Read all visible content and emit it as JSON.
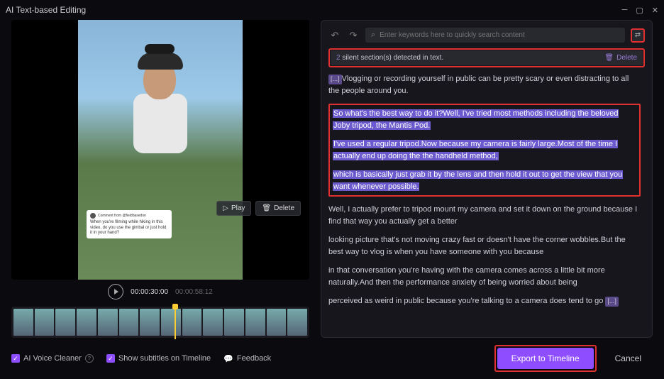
{
  "window": {
    "title": "AI Text-based Editing"
  },
  "preview": {
    "subtitle_header": "Comment from @fieldbasedon",
    "subtitle_text": "When you're filming while hiking in this video, do you use the gimbal or just hold it in your hand?",
    "play_label": "Play",
    "delete_label": "Delete"
  },
  "transport": {
    "current": "00:00:30:00",
    "total": "00:00:58:12"
  },
  "search": {
    "placeholder": "Enter keywords here to quickly search content"
  },
  "banner": {
    "count": "2",
    "text": " silent section(s) detected in text.",
    "delete": "Delete"
  },
  "transcript": {
    "p1_sil": "[...]",
    "p1": "Vlogging or recording yourself in public can be pretty scary or even distracting to all the people around you.",
    "h1": "So what's the best way to do it?Well, I've tried most methods including the beloved Joby tripod, the Mantis Pod.",
    "h2": "I've used a regular tripod.Now because my camera is fairly large.Most of the time I actually end up doing the the handheld method,",
    "h3": " which is basically just grab it by the lens and then hold it out to get the view that you want whenever possible.",
    "p2": "Well, I actually prefer to tripod mount my camera and set it down on the ground because I find that way you actually get a better",
    "p3": " looking picture that's not moving crazy fast or doesn't have the corner wobbles.But the best way to vlog is when you have someone with you because",
    "p4": " in that conversation you're having with the camera comes across a little bit more naturally.And then the performance anxiety of being worried about being",
    "p5": " perceived as weird in public because you're talking to a camera does tend to go ",
    "p5_sil": "[...]"
  },
  "footer": {
    "voice_cleaner": "AI Voice Cleaner",
    "subtitles": "Show subtitles on Timeline",
    "feedback": "Feedback",
    "export": "Export to Timeline",
    "cancel": "Cancel"
  }
}
